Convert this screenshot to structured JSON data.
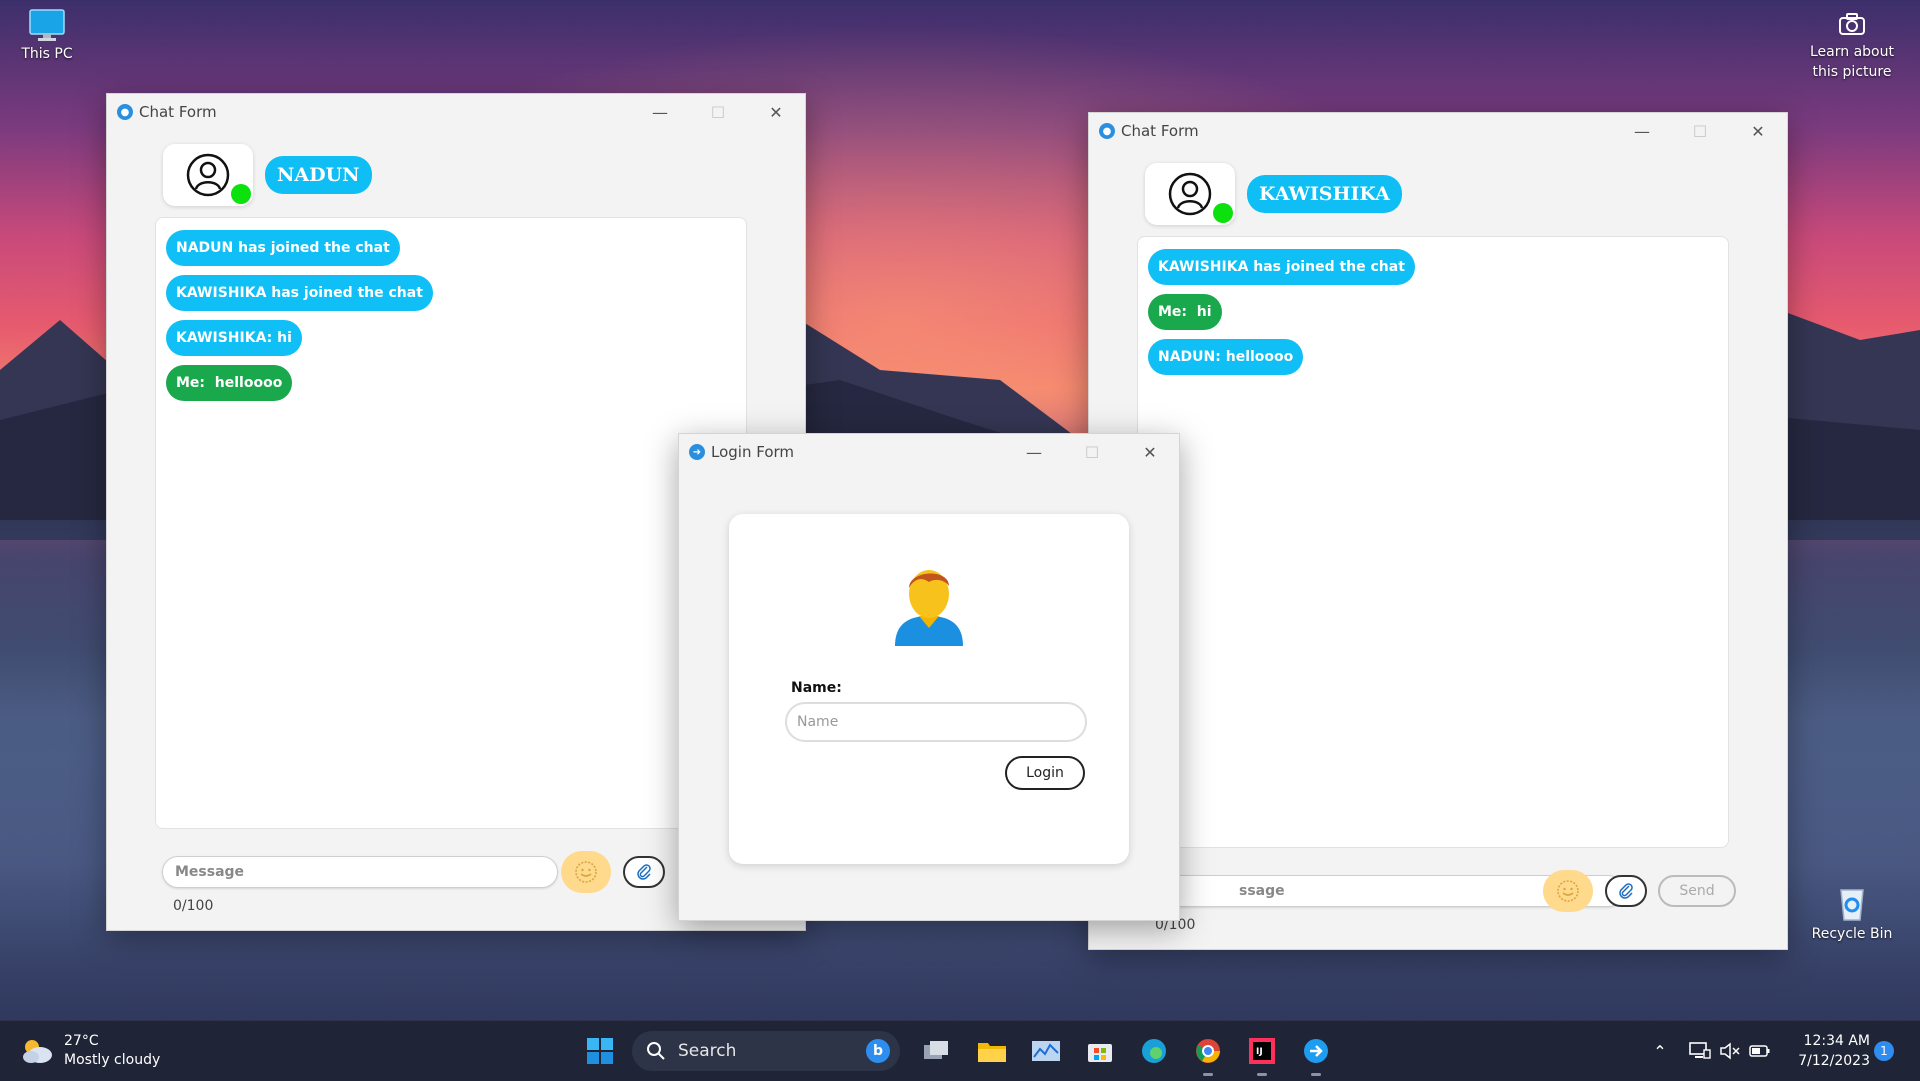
{
  "desktop": {
    "this_pc_label": "This PC",
    "learn_label_line1": "Learn about",
    "learn_label_line2": "this picture",
    "recycle_bin_label": "Recycle Bin"
  },
  "chat_left": {
    "title": "Chat Form",
    "user_name": "NADUN",
    "messages": [
      {
        "text": "NADUN has joined the chat",
        "kind": "other"
      },
      {
        "text": "KAWISHIKA has joined the chat",
        "kind": "other"
      },
      {
        "text": "KAWISHIKA: hi",
        "kind": "other"
      },
      {
        "text": "Me:  helloooo",
        "kind": "me"
      }
    ],
    "message_placeholder": "Message",
    "counter": "0/100"
  },
  "chat_right": {
    "title": "Chat Form",
    "user_name": "KAWISHIKA",
    "messages": [
      {
        "text": "KAWISHIKA has joined the chat",
        "kind": "other"
      },
      {
        "text": "Me:  hi",
        "kind": "me"
      },
      {
        "text": "NADUN: helloooo",
        "kind": "other"
      }
    ],
    "message_placeholder_visible": "ssage",
    "send_label": "Send",
    "counter": "0/100"
  },
  "login": {
    "title": "Login Form",
    "name_label": "Name:",
    "name_placeholder": "Name",
    "login_button": "Login"
  },
  "taskbar": {
    "weather_temp": "27°C",
    "weather_desc": "Mostly cloudy",
    "search_label": "Search",
    "time": "12:34 AM",
    "date": "7/12/2023",
    "notification_count": "1"
  },
  "colors": {
    "bubble_other": "#10bff5",
    "bubble_me": "#1aa84c",
    "online": "#0de10d",
    "emoji_button": "#ffd98c"
  }
}
